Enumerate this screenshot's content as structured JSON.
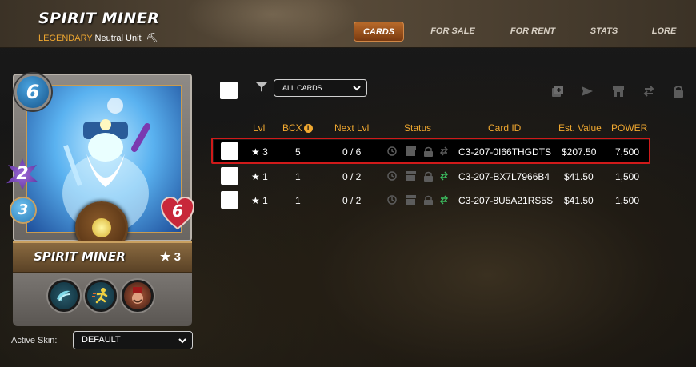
{
  "header": {
    "title": "SPIRIT MINER",
    "rarity": "LEGENDARY",
    "unit_type": "Neutral Unit",
    "nav": [
      {
        "label": "CARDS",
        "active": true
      },
      {
        "label": "FOR SALE",
        "active": false
      },
      {
        "label": "FOR RENT",
        "active": false
      },
      {
        "label": "STATS",
        "active": false
      },
      {
        "label": "LORE",
        "active": false
      }
    ]
  },
  "card": {
    "mana": "6",
    "attack": "2",
    "speed": "3",
    "health": "6",
    "name": "SPIRIT MINER",
    "level": "★ 3",
    "abilities": [
      "wave-icon",
      "runner-icon",
      "fez-face-icon"
    ]
  },
  "skin": {
    "label": "Active Skin:",
    "value": "DEFAULT"
  },
  "filter": {
    "value": "ALL CARDS"
  },
  "toolbar": [
    "combine-icon",
    "send-icon",
    "market-icon",
    "rent-transfer-icon",
    "lock-icon"
  ],
  "table": {
    "headers": {
      "lvl": "Lvl",
      "bcx": "BCX",
      "next_lvl": "Next Lvl",
      "status": "Status",
      "card_id": "Card ID",
      "est_value": "Est. Value",
      "power": "POWER"
    },
    "rows": [
      {
        "lvl": "★ 3",
        "bcx": "5",
        "next": "0 / 6",
        "card_id": "C3-207-0I66THGDTS",
        "value": "$207.50",
        "power": "7,500",
        "highlighted": true
      },
      {
        "lvl": "★ 1",
        "bcx": "1",
        "next": "0 / 2",
        "card_id": "C3-207-BX7L7966B4",
        "value": "$41.50",
        "power": "1,500",
        "highlighted": false
      },
      {
        "lvl": "★ 1",
        "bcx": "1",
        "next": "0 / 2",
        "card_id": "C3-207-8U5A21RS5S",
        "value": "$41.50",
        "power": "1,500",
        "highlighted": false
      }
    ]
  },
  "colors": {
    "accent": "#f0a830",
    "highlight_border": "#d01a1a",
    "active_tab": "#a85a20"
  }
}
